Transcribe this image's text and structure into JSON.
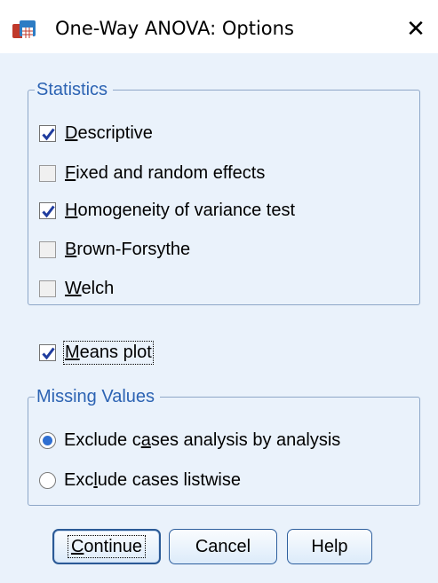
{
  "window": {
    "title": "One-Way ANOVA: Options",
    "close_glyph": "✕",
    "icon": "spss-app-icon"
  },
  "statistics": {
    "legend": "Statistics",
    "items": [
      {
        "mnemonic": "D",
        "rest": "escriptive",
        "checked": true
      },
      {
        "mnemonic": "F",
        "rest": "ixed and random effects",
        "checked": false
      },
      {
        "mnemonic": "H",
        "rest": "omogeneity of variance test",
        "checked": true
      },
      {
        "mnemonic": "B",
        "rest": "rown-Forsythe",
        "checked": false
      },
      {
        "mnemonic": "W",
        "rest": "elch",
        "checked": false
      }
    ]
  },
  "means_plot": {
    "mnemonic": "M",
    "rest": "eans plot",
    "checked": true
  },
  "missing_values": {
    "legend": "Missing Values",
    "options": [
      {
        "before": "Exclude c",
        "mnemonic": "a",
        "after": "ses analysis by analysis",
        "selected": true
      },
      {
        "before": "Exc",
        "mnemonic": "l",
        "after": "ude cases listwise",
        "selected": false
      }
    ]
  },
  "buttons": {
    "continue": {
      "mnemonic": "C",
      "rest": "ontinue"
    },
    "cancel": "Cancel",
    "help": "Help"
  },
  "colors": {
    "legend_text": "#2c63b3",
    "check_mark": "#1f3c9e",
    "radio_dot": "#2f6fd1",
    "background": "#eaf2fb"
  }
}
